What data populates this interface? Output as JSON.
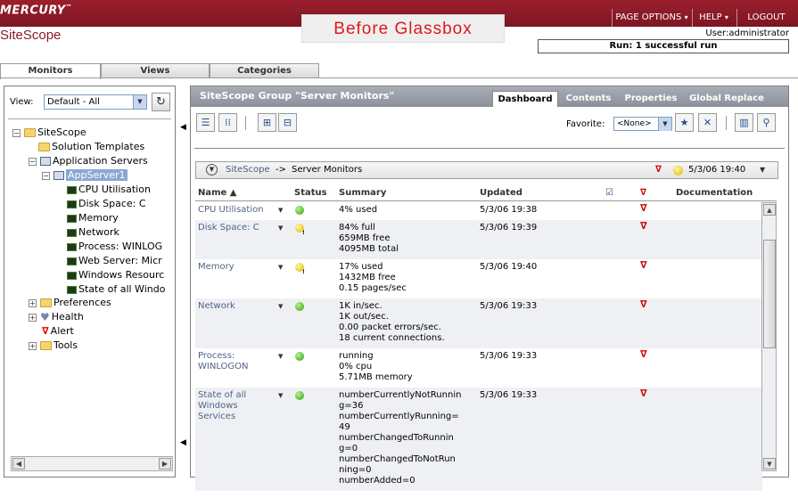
{
  "brand": {
    "mercury": "MERCURY",
    "tm": "™",
    "sitescope": "SiteScope"
  },
  "overlay_title": "Before Glassbox",
  "topnav": {
    "page_options": "PAGE OPTIONS",
    "help": "HELP",
    "logout": "LOGOUT",
    "arrow": "▾"
  },
  "user": {
    "line": "User:administrator"
  },
  "run_status": "Run: 1 successful run",
  "outer_tabs": [
    {
      "label": "Monitors"
    },
    {
      "label": "Views"
    },
    {
      "label": "Categories"
    }
  ],
  "left": {
    "view_label": "View:",
    "view_value": "Default - All",
    "tree": {
      "sitescope": "SiteScope",
      "solution_templates": "Solution Templates",
      "application_servers": "Application Servers",
      "appserver1": "AppServer1",
      "cpu": "CPU Utilisation",
      "disk": "Disk Space: C",
      "memory": "Memory",
      "network": "Network",
      "process": "Process: WINLOG",
      "web": "Web Server: Micr",
      "winres": "Windows Resourc",
      "state": "State of all Windo",
      "preferences": "Preferences",
      "health": "Health",
      "alert": "Alert",
      "tools": "Tools"
    }
  },
  "main": {
    "group_title": "SiteScope Group \"Server Monitors\"",
    "tabs": [
      {
        "label": "Dashboard"
      },
      {
        "label": "Contents"
      },
      {
        "label": "Properties"
      },
      {
        "label": "Global Replace"
      }
    ],
    "favorite_label": "Favorite:",
    "favorite_value": "<None>",
    "breadcrumb": {
      "link": "SiteScope",
      "sep": "->",
      "current": "Server Monitors",
      "time": "5/3/06 19:40"
    },
    "columns": {
      "name": "Name",
      "status": "Status",
      "summary": "Summary",
      "updated": "Updated",
      "documentation": "Documentation"
    },
    "rows": [
      {
        "name": [
          "CPU Utilisation"
        ],
        "status": "good",
        "summary": [
          "4% used"
        ],
        "updated": "5/3/06 19:38"
      },
      {
        "name": [
          "Disk Space: C"
        ],
        "status": "warn",
        "summary": [
          "84% full",
          "659MB free",
          "4095MB total"
        ],
        "updated": "5/3/06 19:39"
      },
      {
        "name": [
          "Memory"
        ],
        "status": "warn",
        "summary": [
          "17% used",
          "1432MB free",
          "0.15 pages/sec"
        ],
        "updated": "5/3/06 19:40"
      },
      {
        "name": [
          "Network"
        ],
        "status": "good",
        "summary": [
          "1K in/sec.",
          "1K out/sec.",
          "0.00 packet errors/sec.",
          "18 current connections."
        ],
        "updated": "5/3/06 19:33"
      },
      {
        "name": [
          "Process:",
          "WINLOGON"
        ],
        "status": "good",
        "summary": [
          "running",
          "0% cpu",
          "5.71MB memory"
        ],
        "updated": "5/3/06 19:33"
      },
      {
        "name": [
          "State of all",
          "Windows",
          "Services"
        ],
        "status": "good",
        "summary": [
          "numberCurrentlyNotRunnin",
          "g=36",
          "numberCurrentlyRunning=",
          "49",
          "numberChangedToRunnin",
          "g=0",
          "numberChangedToNotRun",
          "ning=0",
          "numberAdded=0"
        ],
        "updated": "5/3/06 19:33"
      }
    ]
  },
  "colors": {
    "header_red": "#8a1a28",
    "accent_blue": "#506487",
    "status_good": "#2e9d12",
    "status_warn": "#e0b400",
    "alert_red": "#cc0000"
  }
}
